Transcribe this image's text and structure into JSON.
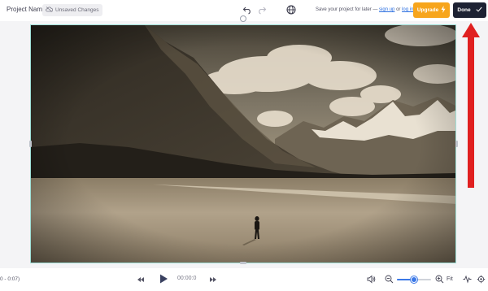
{
  "header": {
    "project_name": "Project Name",
    "unsaved_label": "Unsaved Changes",
    "save_hint_prefix": "Save your project for later — ",
    "sign_up": "sign up",
    "save_hint_or": " or ",
    "log_in": "log in",
    "upgrade_label": "Upgrade",
    "done_label": "Done"
  },
  "icons": {
    "undo": "undo-icon",
    "redo": "redo-icon",
    "globe": "globe-icon",
    "upgrade": "lightning-icon",
    "done": "check-icon",
    "rewind": "rewind-icon",
    "play": "play-icon",
    "forward": "fast-forward-icon",
    "volume": "volume-icon",
    "zoom_out": "zoom-out-icon",
    "zoom_in": "zoom-in-icon",
    "waveform": "waveform-icon",
    "settings": "settings-icon"
  },
  "playback": {
    "range_text": "0 - 0:07)",
    "timecode": "00:00:0",
    "zoom_level": 0.5,
    "fit_label": "Fit"
  },
  "colors": {
    "upgrade": "#f7a51c",
    "done": "#1d2233",
    "accent": "#3b78e7",
    "annotation_arrow": "#e02020",
    "selection_border": "#9fe0d8"
  }
}
